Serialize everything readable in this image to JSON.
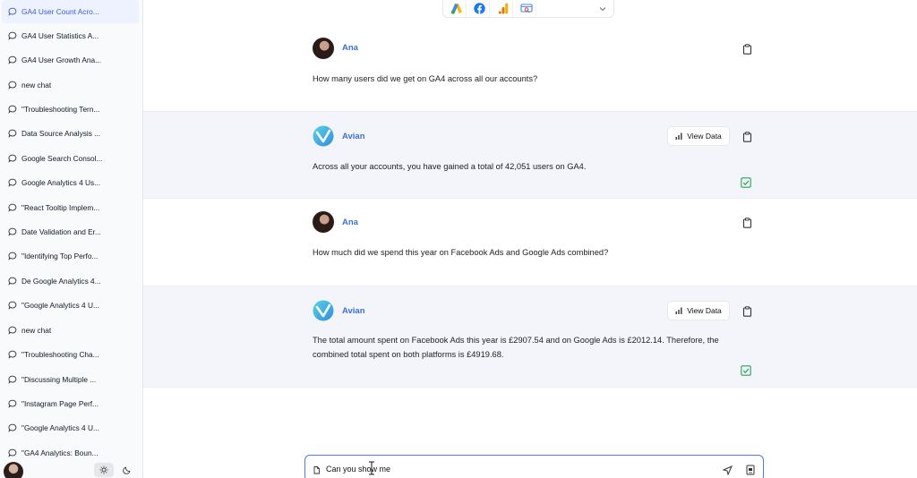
{
  "sidebar": {
    "items": [
      {
        "label": "GA4 User Count Acro...",
        "active": true
      },
      {
        "label": "GA4 User Statistics A..."
      },
      {
        "label": "GA4 User Growth Ana..."
      },
      {
        "label": "new chat"
      },
      {
        "label": "\"Troubleshooting Tern..."
      },
      {
        "label": "Data Source Analysis ..."
      },
      {
        "label": "Google Search Consol..."
      },
      {
        "label": "Google Analytics 4 Us..."
      },
      {
        "label": "\"React Tooltip Implem..."
      },
      {
        "label": "Date Validation and Er..."
      },
      {
        "label": "\"Identifying Top Perfo..."
      },
      {
        "label": "De Google Analytics 4..."
      },
      {
        "label": "\"Google Analytics 4 U..."
      },
      {
        "label": "new chat"
      },
      {
        "label": "\"Troubleshooting Cha..."
      },
      {
        "label": "\"Discussing Multiple ..."
      },
      {
        "label": "\"Instagram Page Perf..."
      },
      {
        "label": "\"Google Analytics 4 U..."
      },
      {
        "label": "\"GA4 Analytics: Boun..."
      }
    ]
  },
  "sources": [
    "google-ads-icon",
    "facebook-icon",
    "google-analytics-icon",
    "search-console-icon"
  ],
  "messages": [
    {
      "role": "user",
      "name": "Ana",
      "text": "How many users did we get on GA4 across all our accounts?"
    },
    {
      "role": "bot",
      "name": "Avian",
      "view_label": "View Data",
      "text": "Across all your accounts, you have gained a total of 42,051 users on GA4."
    },
    {
      "role": "user",
      "name": "Ana",
      "text": "How much did we spend this year on Facebook Ads and Google Ads combined?"
    },
    {
      "role": "bot",
      "name": "Avian",
      "view_label": "View Data",
      "text": "The total amount spent on Facebook Ads this year is £2907.54 and on Google Ads is £2012.14. Therefore, the combined total spent on both platforms is £4919.68."
    }
  ],
  "composer": {
    "value": "Can you show me"
  },
  "colors": {
    "accent": "#3b6fd8",
    "bot_bg": "#f4f5fb",
    "check": "#22a55a",
    "input_border": "#4f7be8"
  }
}
